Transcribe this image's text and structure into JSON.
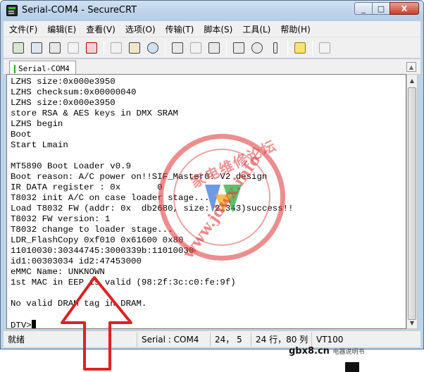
{
  "window": {
    "title": "Serial-COM4 - SecureCRT",
    "controls": [
      "_",
      "□",
      "X"
    ]
  },
  "menu": [
    "文件(F)",
    "编辑(E)",
    "查看(V)",
    "选项(O)",
    "传输(T)",
    "脚本(S)",
    "工具(L)",
    "帮助(H)"
  ],
  "toolbar": {
    "icons": [
      "connect-icon",
      "quick-connect-icon",
      "connect-in-tab-icon",
      "reconnect-icon",
      "disconnect-icon",
      "copy-icon",
      "paste-icon",
      "find-icon",
      "print-icon",
      "print-selection-icon",
      "printer-setup-icon",
      "session-options-icon",
      "global-options-icon",
      "keymap-icon",
      "help-icon",
      "sftp-icon"
    ]
  },
  "tab": {
    "label": "Serial-COM4"
  },
  "terminal": {
    "lines": [
      "LZHS size:0x000e3950",
      "LZHS checksum:0x00000040",
      "LZHS size:0x000e3950",
      "store RSA & AES keys in DMX SRAM",
      "LZHS begin",
      "Boot",
      "Start Lmain",
      "",
      "MT5890 Boot Loader v0.9",
      "Boot reason: A/C power on!!SIF_Master0: V2 design",
      "IR DATA register : 0x       0",
      "T8032 init A/C on case loader stage...",
      "Load T8032 FW (addr: 0x  db2680, size: 21343)success!!",
      "T8032 FW version: 1",
      "T8032 change to loader stage...",
      "LDR_FlashCopy 0xf010 0x61600 0x80",
      "11010030:30344745:3000339b:11010030",
      "id1:00303034 id2:47453000",
      "eMMC Name: UNKNOWN",
      "1st MAC in EEP is valid (98:2f:3c:c0:fe:9f)",
      "",
      "No valid DRAM tag in DRAM.",
      "",
      "DTV>"
    ]
  },
  "status": {
    "ready": "就绪",
    "session": "Serial : COM4",
    "cursor_pos": "24，  5",
    "rows_cols": "24 行，80 列",
    "emulation": "VT100"
  },
  "watermark": {
    "url": "www.jdwx.info",
    "cn": "家电维修论坛"
  },
  "footer_text": {
    "main": "gbx8.cn",
    "sub": "电器说明书"
  },
  "colors": {
    "titlebar": "#bcd3ea",
    "watermark": "#dc3232",
    "arrow": "#e02020"
  }
}
